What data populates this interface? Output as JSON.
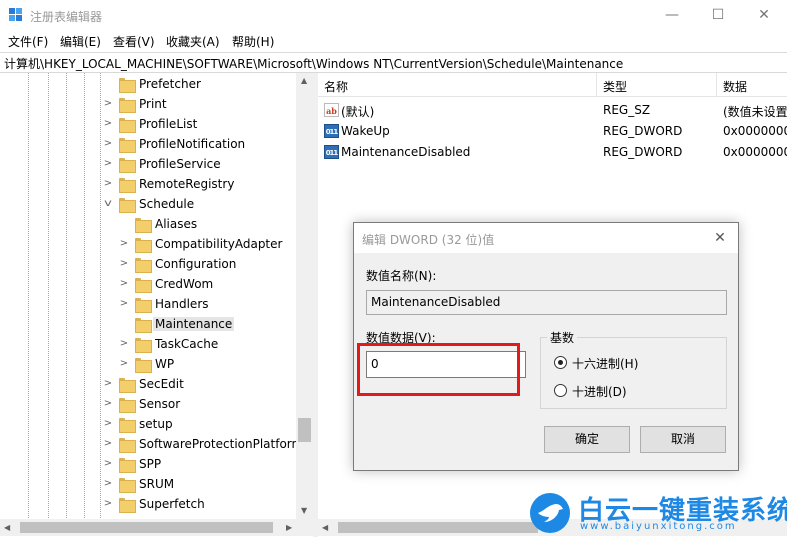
{
  "window": {
    "title": "注册表编辑器",
    "controls": {
      "minimize": "—",
      "maximize": "☐",
      "close": "✕"
    }
  },
  "menu": [
    "文件(F)",
    "编辑(E)",
    "查看(V)",
    "收藏夹(A)",
    "帮助(H)"
  ],
  "address": "计算机\\HKEY_LOCAL_MACHINE\\SOFTWARE\\Microsoft\\Windows NT\\CurrentVersion\\Schedule\\Maintenance",
  "tree": [
    {
      "label": "Prefetcher",
      "expander": ""
    },
    {
      "label": "Print",
      "expander": ">"
    },
    {
      "label": "ProfileList",
      "expander": ">"
    },
    {
      "label": "ProfileNotification",
      "expander": ">"
    },
    {
      "label": "ProfileService",
      "expander": ">"
    },
    {
      "label": "RemoteRegistry",
      "expander": ">"
    },
    {
      "label": "Schedule",
      "expander": "v"
    },
    {
      "label": "Aliases",
      "expander": ""
    },
    {
      "label": "CompatibilityAdapter",
      "expander": ">"
    },
    {
      "label": "Configuration",
      "expander": ">"
    },
    {
      "label": "CredWom",
      "expander": ">"
    },
    {
      "label": "Handlers",
      "expander": ">"
    },
    {
      "label": "Maintenance",
      "expander": "",
      "selected": true
    },
    {
      "label": "TaskCache",
      "expander": ">"
    },
    {
      "label": "WP",
      "expander": ">"
    },
    {
      "label": "SecEdit",
      "expander": ">"
    },
    {
      "label": "Sensor",
      "expander": ">"
    },
    {
      "label": "setup",
      "expander": ">"
    },
    {
      "label": "SoftwareProtectionPlatform",
      "expander": ">"
    },
    {
      "label": "SPP",
      "expander": ">"
    },
    {
      "label": "SRUM",
      "expander": ">"
    },
    {
      "label": "Superfetch",
      "expander": ">"
    }
  ],
  "list": {
    "columns": {
      "name": "名称",
      "type": "类型",
      "data": "数据"
    },
    "rows": [
      {
        "icon": "string-value-icon",
        "glyph": "ab",
        "name": "(默认)",
        "type": "REG_SZ",
        "data": "(数值未设置"
      },
      {
        "icon": "binary-value-icon",
        "glyph": "011",
        "name": "WakeUp",
        "type": "REG_DWORD",
        "data": "0x0000000"
      },
      {
        "icon": "binary-value-icon",
        "glyph": "011",
        "name": "MaintenanceDisabled",
        "type": "REG_DWORD",
        "data": "0x0000000"
      }
    ]
  },
  "dialog": {
    "title": "编辑 DWORD (32 位)值",
    "close": "✕",
    "name_label": "数值名称(N):",
    "name_value": "MaintenanceDisabled",
    "data_label": "数值数据(V):",
    "data_value": "0",
    "base_label": "基数",
    "radio_hex": "十六进制(H)",
    "radio_dec": "十进制(D)",
    "base_selected": "hex",
    "ok": "确定",
    "cancel": "取消"
  },
  "watermark": {
    "text": "白云一键重装系统",
    "url": "www.baiyunxitong.com"
  },
  "colors": {
    "highlight": "#e01b1b",
    "folder": "#f3cf6c",
    "brand": "#1e88e5"
  }
}
